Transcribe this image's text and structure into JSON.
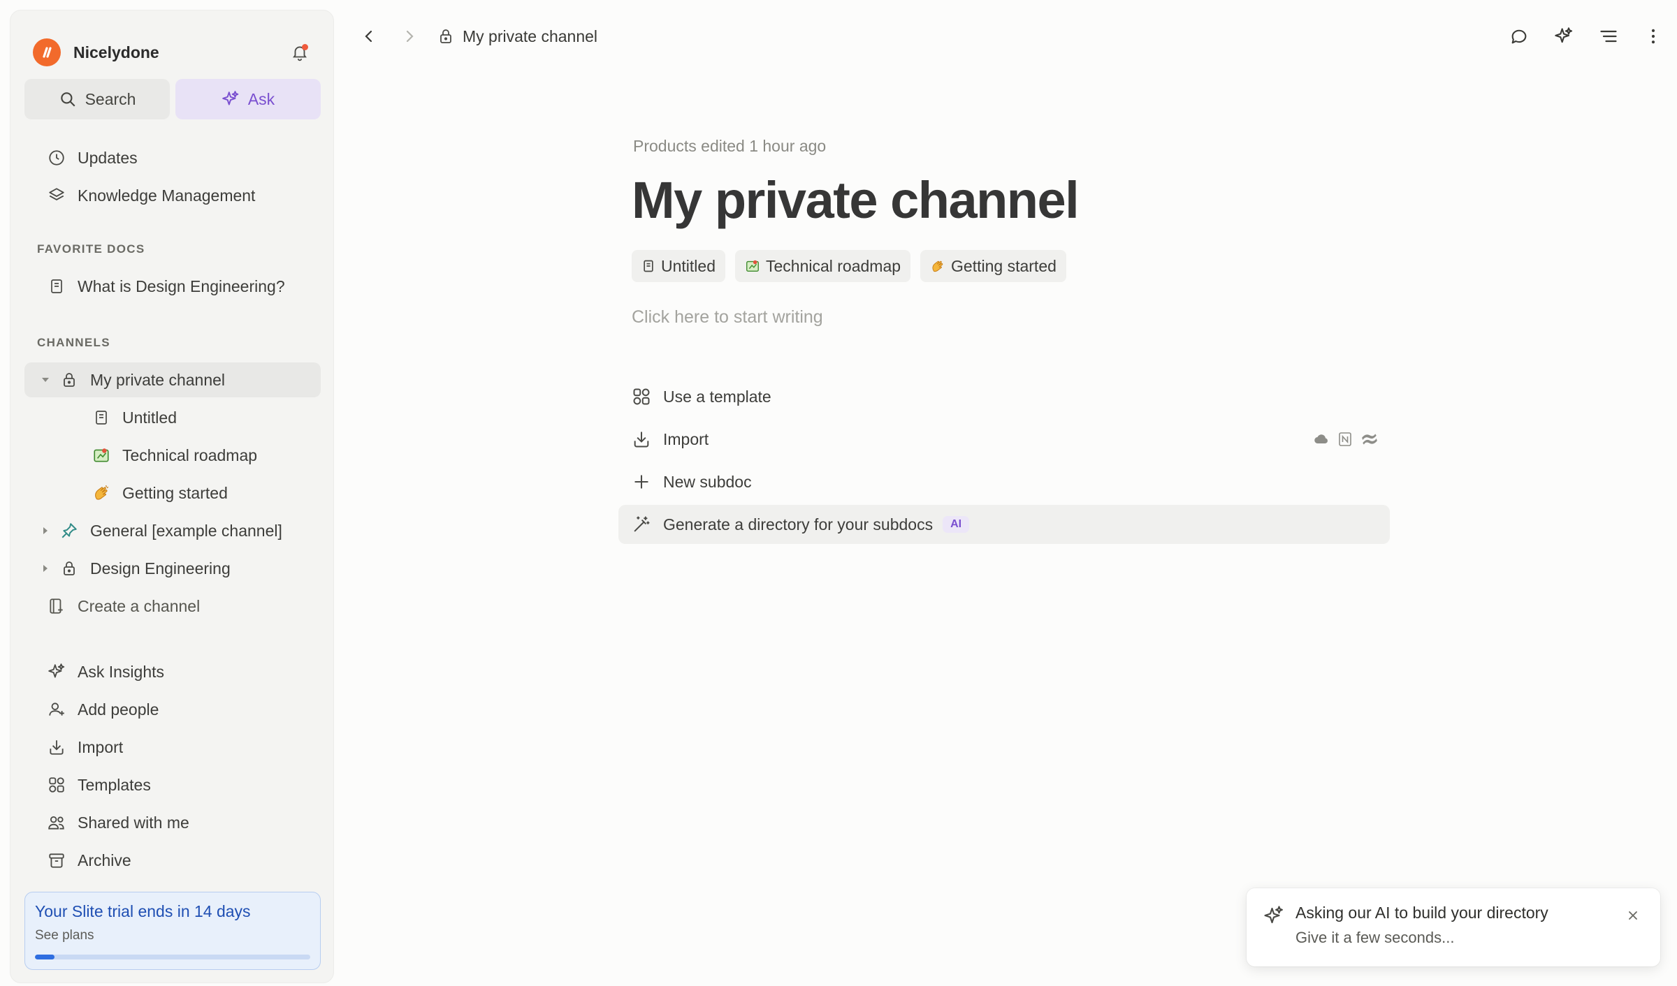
{
  "workspace": {
    "name": "Nicelydone"
  },
  "sidebar": {
    "search_label": "Search",
    "ask_label": "Ask",
    "top_items": [
      {
        "label": "Updates",
        "icon": "clock-icon"
      },
      {
        "label": "Knowledge Management",
        "icon": "layers-icon"
      }
    ],
    "favorites_heading": "FAVORITE DOCS",
    "favorites": [
      {
        "label": "What is Design Engineering?",
        "icon": "document-icon"
      }
    ],
    "channels_heading": "CHANNELS",
    "channels": [
      {
        "label": "My private channel",
        "icon": "lock-icon",
        "expanded": true,
        "active": true,
        "children": [
          {
            "label": "Untitled",
            "icon": "document-icon"
          },
          {
            "label": "Technical roadmap",
            "icon": "map-icon"
          },
          {
            "label": "Getting started",
            "icon": "clapping-hands-icon"
          }
        ]
      },
      {
        "label": "General [example channel]",
        "icon": "pin-icon",
        "expanded": false
      },
      {
        "label": "Design Engineering",
        "icon": "lock-icon",
        "expanded": false
      }
    ],
    "create_channel_label": "Create a channel",
    "bottom_items": [
      {
        "label": "Ask Insights",
        "icon": "sparkle-icon"
      },
      {
        "label": "Add people",
        "icon": "add-person-icon"
      },
      {
        "label": "Import",
        "icon": "import-icon"
      },
      {
        "label": "Templates",
        "icon": "templates-icon"
      },
      {
        "label": "Shared with me",
        "icon": "people-icon"
      },
      {
        "label": "Archive",
        "icon": "archive-icon"
      }
    ],
    "trial": {
      "title": "Your Slite trial ends in 14 days",
      "subtitle": "See plans",
      "progress": 0.07
    }
  },
  "topbar": {
    "breadcrumb": "My private channel"
  },
  "doc": {
    "edited": "Products edited 1 hour ago",
    "title": "My private channel",
    "chips": [
      {
        "label": "Untitled",
        "icon": "document-icon"
      },
      {
        "label": "Technical roadmap",
        "icon": "map-icon"
      },
      {
        "label": "Getting started",
        "icon": "clapping-hands-icon"
      }
    ],
    "placeholder": "Click here to start writing",
    "actions": [
      {
        "label": "Use a template",
        "icon": "templates-icon"
      },
      {
        "label": "Import",
        "icon": "import-icon"
      },
      {
        "label": "New subdoc",
        "icon": "plus-icon"
      },
      {
        "label": "Generate a directory for your subdocs",
        "icon": "magic-wand-icon",
        "badge": "AI"
      }
    ]
  },
  "toast": {
    "title": "Asking our AI to build your directory",
    "subtitle": "Give it a few seconds..."
  },
  "colors": {
    "accent_purple": "#7a4fd0",
    "brand_orange": "#f26a2b",
    "trial_blue": "#1f4fb3"
  }
}
